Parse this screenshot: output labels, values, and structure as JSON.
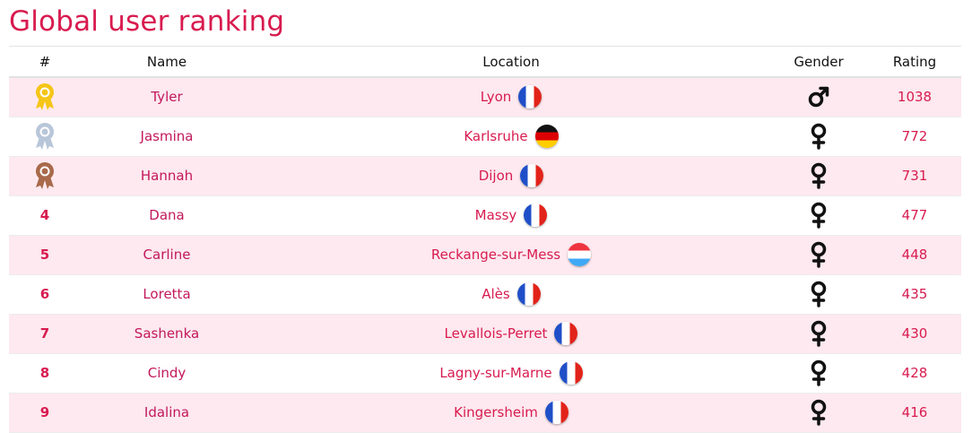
{
  "page": {
    "title": "Global user ranking"
  },
  "table": {
    "headers": {
      "rank": "#",
      "name": "Name",
      "location": "Location",
      "gender": "Gender",
      "rating": "Rating"
    },
    "rows": [
      {
        "rank": "",
        "medal": "gold",
        "name": "Tyler",
        "location": "Lyon",
        "flag": "fr",
        "gender": "male",
        "rating": "1038"
      },
      {
        "rank": "",
        "medal": "silver",
        "name": "Jasmina",
        "location": "Karlsruhe",
        "flag": "de",
        "gender": "female",
        "rating": "772"
      },
      {
        "rank": "",
        "medal": "bronze",
        "name": "Hannah",
        "location": "Dijon",
        "flag": "fr",
        "gender": "female",
        "rating": "731"
      },
      {
        "rank": "4",
        "medal": "",
        "name": "Dana",
        "location": "Massy",
        "flag": "fr",
        "gender": "female",
        "rating": "477"
      },
      {
        "rank": "5",
        "medal": "",
        "name": "Carline",
        "location": "Reckange-sur-Mess",
        "flag": "lu",
        "gender": "female",
        "rating": "448"
      },
      {
        "rank": "6",
        "medal": "",
        "name": "Loretta",
        "location": "Alès",
        "flag": "fr",
        "gender": "female",
        "rating": "435"
      },
      {
        "rank": "7",
        "medal": "",
        "name": "Sashenka",
        "location": "Levallois-Perret",
        "flag": "fr",
        "gender": "female",
        "rating": "430"
      },
      {
        "rank": "8",
        "medal": "",
        "name": "Cindy",
        "location": "Lagny-sur-Marne",
        "flag": "fr",
        "gender": "female",
        "rating": "428"
      },
      {
        "rank": "9",
        "medal": "",
        "name": "Idalina",
        "location": "Kingersheim",
        "flag": "fr",
        "gender": "female",
        "rating": "416"
      }
    ]
  },
  "colors": {
    "accent": "#d81b4f",
    "row_alt_bg": "#fde9ef",
    "medal_gold": "#f5c518",
    "medal_silver": "#b8c6d9",
    "medal_bronze": "#a86a4a"
  }
}
